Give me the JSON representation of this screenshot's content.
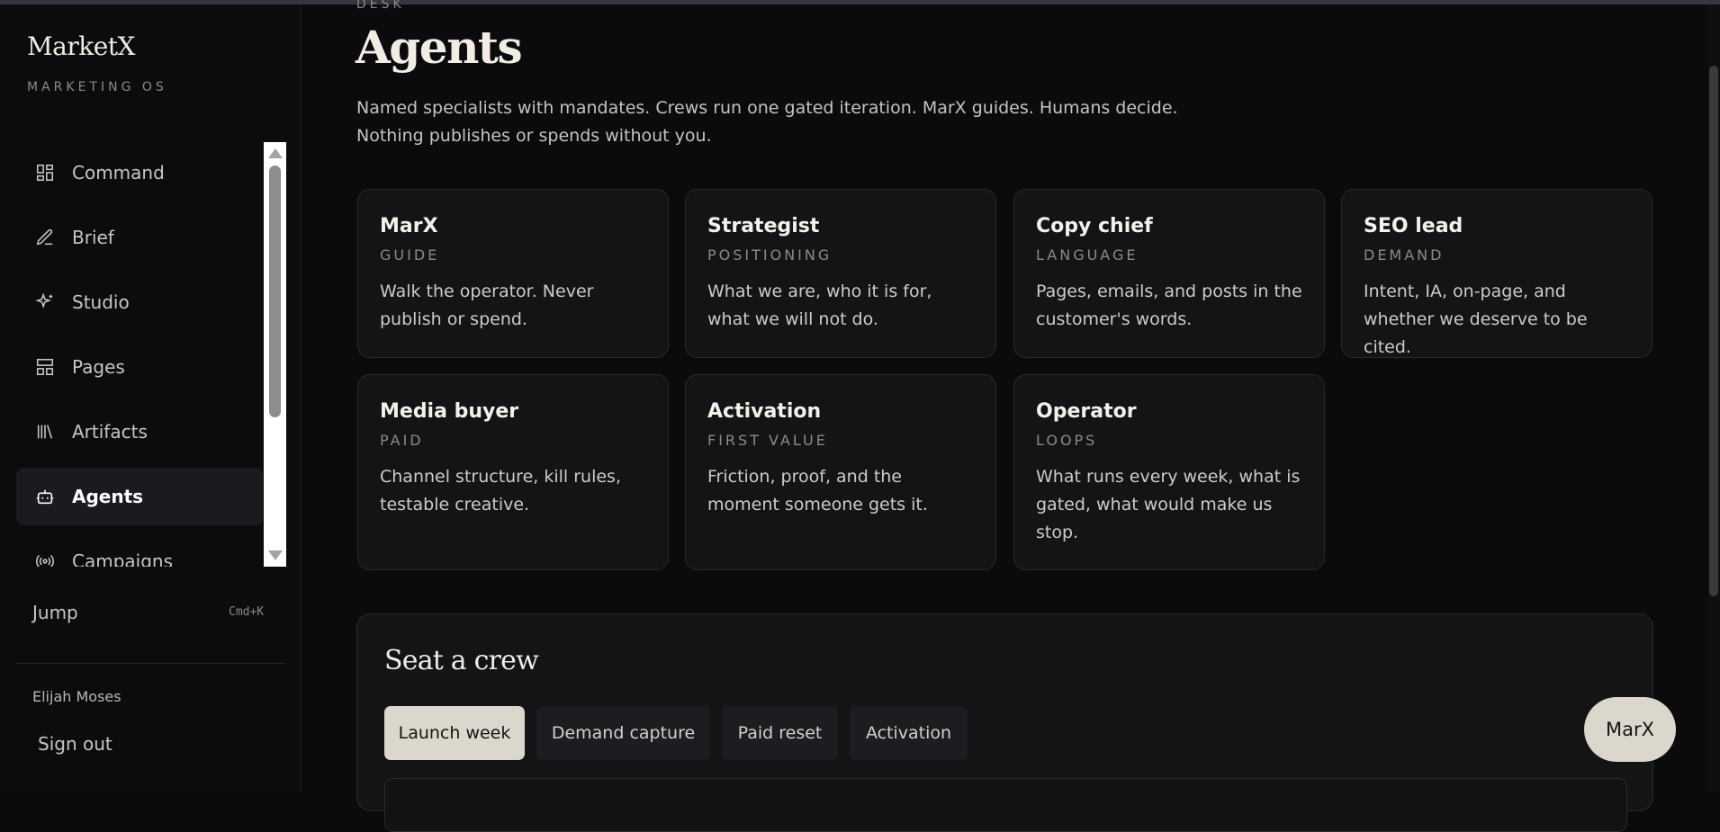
{
  "sidebar": {
    "brand": "MarketX",
    "brand_sub": "MARKETING OS",
    "items": [
      {
        "label": "Command",
        "icon": "grid-icon"
      },
      {
        "label": "Brief",
        "icon": "pen-icon"
      },
      {
        "label": "Studio",
        "icon": "sparkle-icon"
      },
      {
        "label": "Pages",
        "icon": "layout-icon"
      },
      {
        "label": "Artifacts",
        "icon": "library-icon"
      },
      {
        "label": "Agents",
        "icon": "bot-icon",
        "active": true
      },
      {
        "label": "Campaigns",
        "icon": "broadcast-icon"
      }
    ],
    "jump_label": "Jump",
    "jump_shortcut": "Cmd+K",
    "user_name": "Elijah Moses",
    "sign_out": "Sign out"
  },
  "main": {
    "eyebrow": "DESK",
    "title": "Agents",
    "description": "Named specialists with mandates. Crews run one gated iteration. MarX guides. Humans decide. Nothing publishes or spends without you.",
    "agents": [
      {
        "name": "MarX",
        "role": "GUIDE",
        "desc": "Walk the operator. Never publish or spend."
      },
      {
        "name": "Strategist",
        "role": "POSITIONING",
        "desc": "What we are, who it is for, what we will not do."
      },
      {
        "name": "Copy chief",
        "role": "LANGUAGE",
        "desc": "Pages, emails, and posts in the customer's words."
      },
      {
        "name": "SEO lead",
        "role": "DEMAND",
        "desc": "Intent, IA, on-page, and whether we deserve to be cited."
      },
      {
        "name": "Media buyer",
        "role": "PAID",
        "desc": "Channel structure, kill rules, testable creative."
      },
      {
        "name": "Activation",
        "role": "FIRST VALUE",
        "desc": "Friction, proof, and the moment someone gets it."
      },
      {
        "name": "Operator",
        "role": "LOOPS",
        "desc": "What runs every week, what is gated, what would make us stop."
      }
    ],
    "crew": {
      "title": "Seat a crew",
      "tabs": [
        "Launch week",
        "Demand capture",
        "Paid reset",
        "Activation"
      ],
      "active_tab": "Launch week"
    }
  },
  "fab": {
    "label": "MarX"
  },
  "colors": {
    "background": "#0b0b0d",
    "card": "#141417",
    "accent": "#dcd7cc"
  }
}
